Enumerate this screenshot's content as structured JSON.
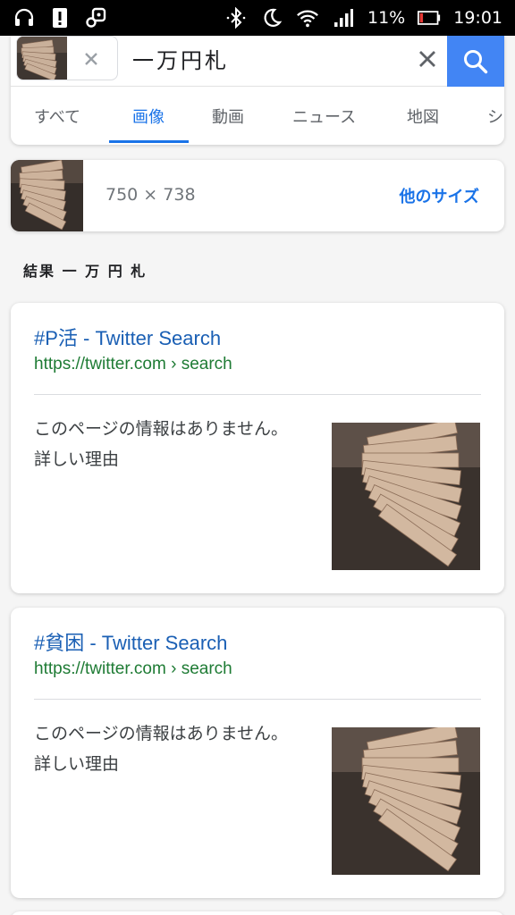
{
  "status_bar": {
    "battery": "11%",
    "time": "19:01",
    "icons": [
      "headset-icon",
      "notification-alert-icon",
      "link-icon",
      "bluetooth-icon",
      "moon-icon",
      "wifi-icon",
      "signal-icon",
      "battery-icon"
    ]
  },
  "search": {
    "query": "一万円札",
    "thumbnail": "banknotes-thumbnail",
    "clear_icon": "close-icon",
    "search_icon": "search-icon"
  },
  "tabs": [
    {
      "label": "すべて",
      "active": false
    },
    {
      "label": "画像",
      "active": true
    },
    {
      "label": "動画",
      "active": false
    },
    {
      "label": "ニュース",
      "active": false
    },
    {
      "label": "地図",
      "active": false
    },
    {
      "label": "シ",
      "active": false
    }
  ],
  "image_info": {
    "dimensions": "750 × 738",
    "more_sizes": "他のサイズ"
  },
  "results_heading": "結果 一 万 円 札",
  "results": [
    {
      "title": "#P活 - Twitter Search",
      "url": "https://twitter.com › search",
      "description": "このページの情報はありません。",
      "link": "詳しい理由"
    },
    {
      "title": "#貧困 - Twitter Search",
      "url": "https://twitter.com › search",
      "description": "このページの情報はありません。",
      "link": "詳しい理由"
    }
  ],
  "colors": {
    "accent": "#1a73e8",
    "search_button": "#4285f4",
    "url_green": "#1e7b34",
    "title_blue": "#1a5fb4"
  }
}
